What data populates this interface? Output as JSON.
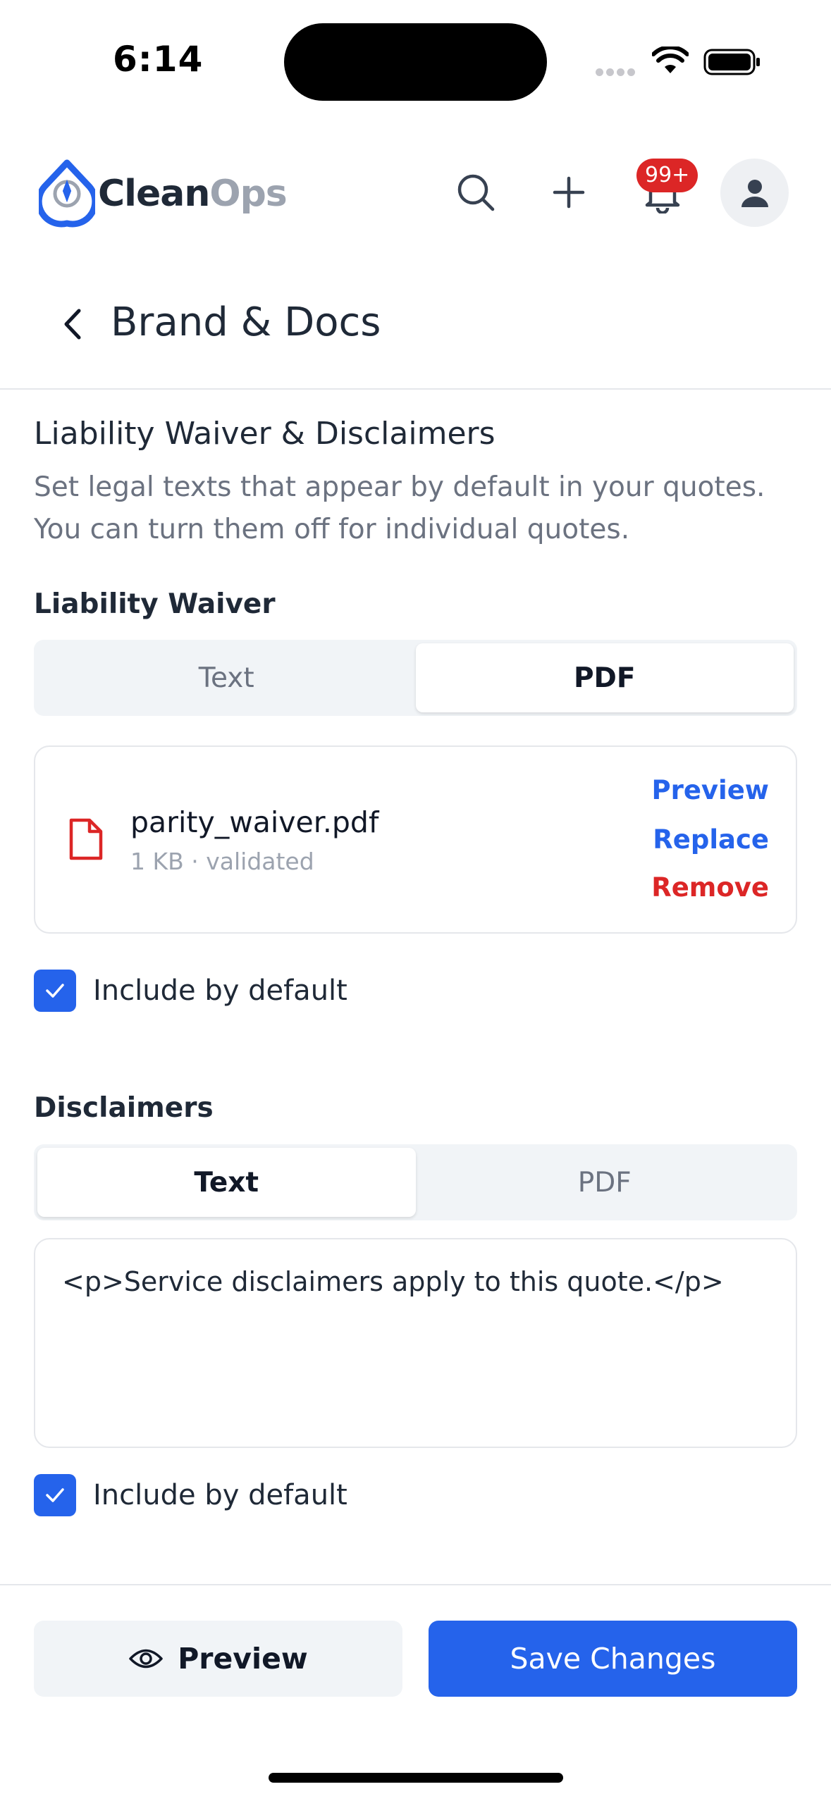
{
  "status_bar": {
    "time": "6:14"
  },
  "header": {
    "logo_part1": "Clean",
    "logo_part2": "Ops",
    "notification_badge": "99+"
  },
  "page": {
    "title": "Brand & Docs"
  },
  "section": {
    "title": "Liability Waiver & Disclaimers",
    "description": "Set legal texts that appear by default in your quotes. You can turn them off for individual quotes."
  },
  "liability_waiver": {
    "label": "Liability Waiver",
    "tabs": [
      {
        "label": "Text",
        "active": false
      },
      {
        "label": "PDF",
        "active": true
      }
    ],
    "file": {
      "name": "parity_waiver.pdf",
      "meta": "1 KB · validated",
      "preview_label": "Preview",
      "replace_label": "Replace",
      "remove_label": "Remove"
    },
    "include_label": "Include by default",
    "include_checked": true
  },
  "disclaimers": {
    "label": "Disclaimers",
    "tabs": [
      {
        "label": "Text",
        "active": true
      },
      {
        "label": "PDF",
        "active": false
      }
    ],
    "text_value": "<p>Service disclaimers apply to this quote.</p>",
    "include_label": "Include by default",
    "include_checked": true
  },
  "footer": {
    "preview_label": "Preview",
    "save_label": "Save Changes"
  },
  "colors": {
    "accent": "#2563eb",
    "danger": "#dc2626",
    "muted": "#6b7280"
  },
  "icons": [
    "search-icon",
    "plus-icon",
    "bell-icon",
    "user-icon",
    "chevron-left-icon",
    "file-icon",
    "check-icon",
    "eye-icon"
  ]
}
